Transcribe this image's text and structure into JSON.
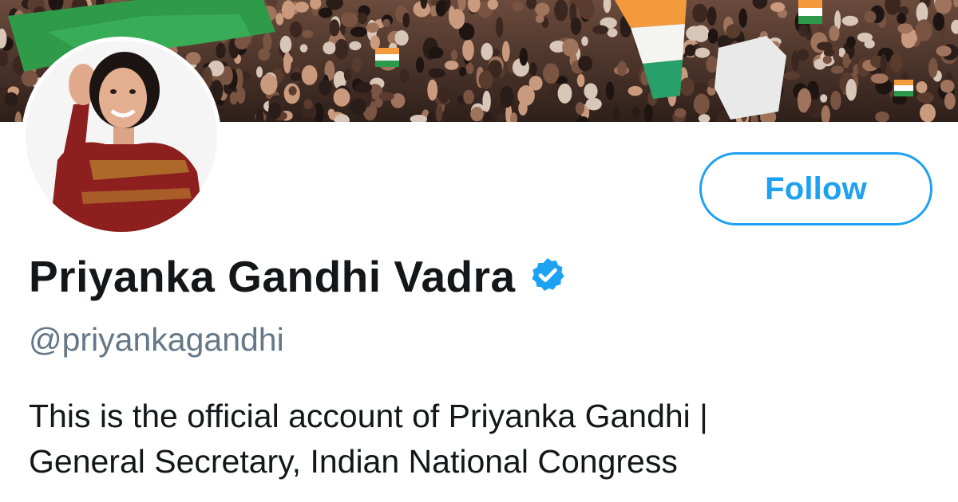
{
  "profile": {
    "display_name": "Priyanka Gandhi Vadra",
    "verified": true,
    "handle": "@priyankagandhi",
    "bio_lines": [
      "This is the official account of Priyanka Gandhi |",
      "General Secretary, Indian National Congress"
    ]
  },
  "actions": {
    "follow_label": "Follow"
  },
  "colors": {
    "accent": "#1da1f2",
    "name_text": "#14171a",
    "handle_text": "#657786",
    "bio_text": "#14171a"
  },
  "icons": {
    "verified": "verified-badge-icon"
  }
}
